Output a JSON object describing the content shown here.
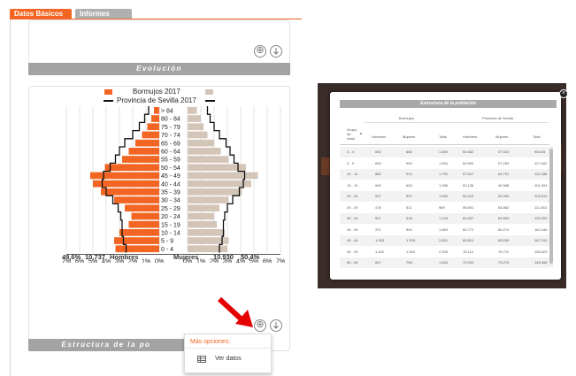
{
  "tabs": [
    {
      "label": "Datos Básicos",
      "active": true
    },
    {
      "label": "Informes",
      "active": false
    }
  ],
  "sections": {
    "evolucion_title": "Evolución",
    "estructura_title": "Estructura de la po"
  },
  "icons": {
    "add": "⊕",
    "download": "⊕"
  },
  "colors": {
    "accent": "#f26522",
    "female_bar": "#d4c5b9",
    "header_gray": "#a3a3a3"
  },
  "chart_data": {
    "type": "bar",
    "orientation": "horizontal-pyramid",
    "legend": [
      "Bormujos 2017",
      "Provincia de Sevilla 2017"
    ],
    "age_groups": [
      "> 84",
      "80 - 84",
      "75 - 79",
      "70 - 74",
      "65 - 69",
      "60 - 64",
      "55 - 59",
      "50 - 54",
      "45 - 49",
      "40 - 44",
      "35 - 39",
      "30 - 34",
      "25 - 29",
      "20 - 24",
      "15 - 19",
      "10 - 14",
      "5 - 9",
      "0 - 4"
    ],
    "series": [
      {
        "name": "Hombres",
        "values": [
          0.4,
          0.6,
          0.9,
          1.3,
          1.8,
          2.3,
          2.8,
          4.1,
          5.2,
          5.0,
          4.4,
          3.4,
          2.6,
          2.1,
          2.3,
          3.0,
          3.4,
          3.3
        ]
      },
      {
        "name": "Mujeres",
        "values": [
          0.7,
          1.0,
          1.2,
          1.5,
          2.0,
          2.5,
          3.1,
          4.4,
          5.3,
          4.8,
          4.1,
          3.1,
          2.4,
          2.0,
          2.2,
          2.8,
          3.1,
          3.0
        ]
      },
      {
        "name": "Provincia Hombres",
        "values": [
          0.8,
          1.1,
          1.5,
          2.0,
          2.6,
          3.0,
          3.3,
          3.7,
          4.2,
          4.3,
          4.0,
          3.5,
          3.1,
          2.9,
          2.8,
          2.8,
          2.7,
          2.5
        ]
      },
      {
        "name": "Provincia Mujeres",
        "values": [
          1.5,
          1.7,
          2.0,
          2.4,
          2.9,
          3.2,
          3.5,
          3.8,
          4.3,
          4.2,
          3.9,
          3.4,
          3.0,
          2.8,
          2.7,
          2.7,
          2.6,
          2.4
        ]
      }
    ],
    "x_ticks_left": [
      "7%",
      "6%",
      "5%",
      "4%",
      "3%",
      "2%",
      "1%",
      "0%"
    ],
    "x_ticks_right": [
      "0%",
      "1%",
      "2%",
      "3%",
      "4%",
      "5%",
      "6%",
      "7%"
    ],
    "xlim": [
      0,
      7
    ],
    "totals": {
      "male_pct": "49,6%",
      "male_count": "10.737",
      "male_label": "Hombres",
      "female_label": "Mujeres",
      "female_count": "10.930",
      "female_pct": "50,4%"
    }
  },
  "dropdown": {
    "title": "Más opciones:",
    "item_label": "Ver datos"
  },
  "modal": {
    "title": "Estructura de la población",
    "group_header_1": "Bormujos",
    "group_header_2": "Provincia de Sevilla",
    "columns": [
      "Grupo de edad",
      "Hombres",
      "Mujeres",
      "Total",
      "Hombres",
      "Mujeres",
      "Total"
    ],
    "rows": [
      [
        "0 - 4",
        "692",
        "668",
        "1.359",
        "50.682",
        "47.924",
        "98.618"
      ],
      [
        "5 - 9",
        "845",
        "900",
        "1.834",
        "60.599",
        "57.253",
        "117.842"
      ],
      [
        "10 - 14",
        "882",
        "910",
        "1.792",
        "57.547",
        "54.791",
        "112.338"
      ],
      [
        "15 - 19",
        "663",
        "626",
        "1.288",
        "52.136",
        "49.388",
        "101.524"
      ],
      [
        "20 - 24",
        "537",
        "522",
        "1.059",
        "53.416",
        "51.094",
        "104.510"
      ],
      [
        "25 - 29",
        "478",
        "511",
        "989",
        "58.591",
        "54.862",
        "111.453"
      ],
      [
        "30 - 34",
        "527",
        "618",
        "1.145",
        "64.537",
        "64.663",
        "129.200"
      ],
      [
        "35 - 39",
        "371",
        "900",
        "1.869",
        "80.772",
        "80.274",
        "161.046"
      ],
      [
        "40 - 44",
        "1.253",
        "1.378",
        "2.631",
        "83.801",
        "83.530",
        "167.331"
      ],
      [
        "45 - 49",
        "1.292",
        "1.003",
        "2.295",
        "78.110",
        "78.712",
        "156.823"
      ],
      [
        "50 - 54",
        "847",
        "796",
        "1.643",
        "72.093",
        "74.275",
        "146.368"
      ]
    ]
  }
}
